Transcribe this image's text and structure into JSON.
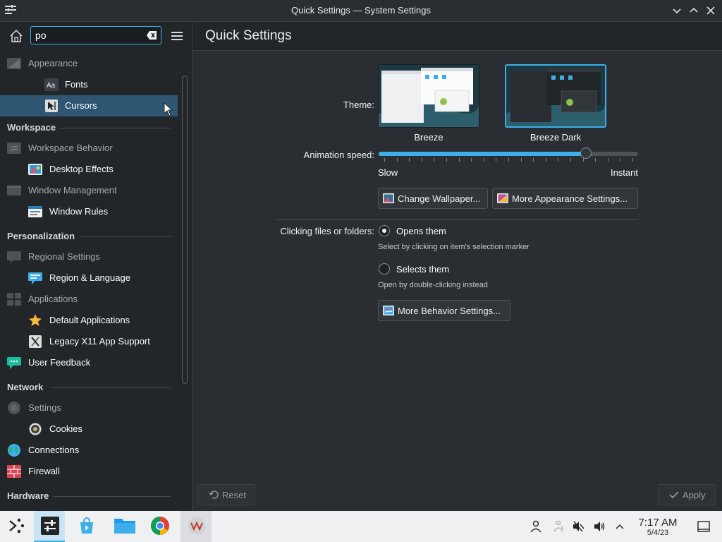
{
  "window": {
    "title": "Quick Settings — System Settings"
  },
  "search": {
    "value": "po",
    "placeholder": ""
  },
  "sidebar": {
    "items": [
      {
        "kind": "cat",
        "label": "Appearance",
        "icon": "appearance-icon"
      },
      {
        "kind": "sub",
        "label": "Fonts",
        "icon": "fonts-icon"
      },
      {
        "kind": "sub",
        "label": "Cursors",
        "icon": "cursors-icon",
        "selected": true
      },
      {
        "kind": "section",
        "label": "Workspace"
      },
      {
        "kind": "cat",
        "label": "Workspace Behavior",
        "icon": "workspace-behavior-icon"
      },
      {
        "kind": "sub",
        "label": "Desktop Effects",
        "icon": "desktop-effects-icon"
      },
      {
        "kind": "cat",
        "label": "Window Management",
        "icon": "window-management-icon"
      },
      {
        "kind": "sub",
        "label": "Window Rules",
        "icon": "window-rules-icon"
      },
      {
        "kind": "section",
        "label": "Personalization"
      },
      {
        "kind": "cat",
        "label": "Regional Settings",
        "icon": "regional-settings-icon"
      },
      {
        "kind": "sub",
        "label": "Region & Language",
        "icon": "region-language-icon"
      },
      {
        "kind": "cat",
        "label": "Applications",
        "icon": "applications-icon"
      },
      {
        "kind": "sub",
        "label": "Default Applications",
        "icon": "star-icon"
      },
      {
        "kind": "sub",
        "label": "Legacy X11 App Support",
        "icon": "x11-icon"
      },
      {
        "kind": "top",
        "label": "User Feedback",
        "icon": "user-feedback-icon"
      },
      {
        "kind": "section",
        "label": "Network"
      },
      {
        "kind": "cat",
        "label": "Settings",
        "icon": "network-settings-icon"
      },
      {
        "kind": "sub",
        "label": "Cookies",
        "icon": "cookies-icon"
      },
      {
        "kind": "top",
        "label": "Connections",
        "icon": "globe-icon"
      },
      {
        "kind": "top",
        "label": "Firewall",
        "icon": "firewall-icon"
      },
      {
        "kind": "section",
        "label": "Hardware"
      }
    ]
  },
  "main": {
    "title": "Quick Settings",
    "theme": {
      "label": "Theme:",
      "options": [
        {
          "name": "Breeze",
          "selected": false
        },
        {
          "name": "Breeze Dark",
          "selected": true
        }
      ]
    },
    "animation": {
      "label": "Animation speed:",
      "min_label": "Slow",
      "max_label": "Instant",
      "value_fraction": 0.8
    },
    "buttons": {
      "wallpaper": "Change Wallpaper...",
      "appearance": "More Appearance Settings...",
      "behavior": "More Behavior Settings..."
    },
    "clicking": {
      "label": "Clicking files or folders:",
      "opt1": "Opens them",
      "opt1_hint": "Select by clicking on item's selection marker",
      "opt2": "Selects them",
      "opt2_hint": "Open by double-clicking instead",
      "selected": "opt1"
    },
    "footer": {
      "reset": "Reset",
      "apply": "Apply"
    }
  },
  "taskbar": {
    "apps": [
      "app-launcher-icon",
      "system-settings-icon",
      "discover-icon",
      "file-manager-icon",
      "chrome-icon",
      "vm-icon"
    ],
    "tray": [
      "user-icon",
      "accessibility-icon",
      "mute-icon",
      "volume-icon",
      "chevron-up-icon"
    ],
    "time": "7:17 AM",
    "date": "5/4/23"
  },
  "colors": {
    "accent": "#3daee9",
    "sidebar_selection": "#2f5774",
    "window_bg": "#2a2e32",
    "taskbar_bg": "#eff0f1"
  }
}
